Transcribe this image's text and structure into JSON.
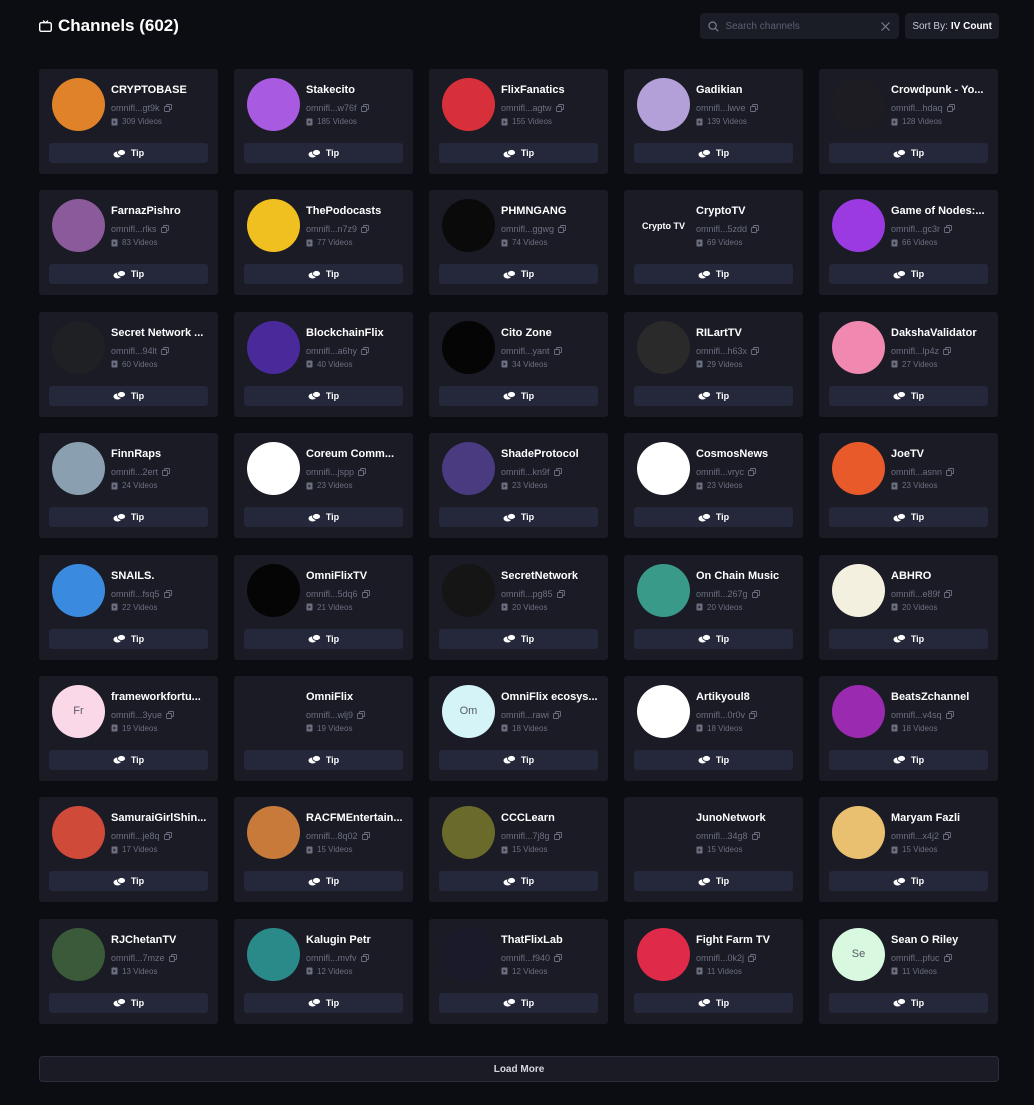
{
  "header": {
    "title": "Channels (602)",
    "search_placeholder": "Search channels",
    "sort_label": "Sort By:",
    "sort_value": "IV Count"
  },
  "tip_label": "Tip",
  "load_more_label": "Load More",
  "channels": [
    {
      "name": "CRYPTOBASE",
      "address": "omnifl...gt9k",
      "videos": "309 Videos",
      "avatar_color": "#e0822a",
      "avatar_text": ""
    },
    {
      "name": "Stakecito",
      "address": "omnifl...w76f",
      "videos": "185 Videos",
      "avatar_color": "#a85ae0",
      "avatar_text": ""
    },
    {
      "name": "FlixFanatics",
      "address": "omnifl...agtw",
      "videos": "155 Videos",
      "avatar_color": "#d8303a",
      "avatar_text": ""
    },
    {
      "name": "Gadikian",
      "address": "omnifl...lwve",
      "videos": "139 Videos",
      "avatar_color": "#b4a0d8",
      "avatar_text": ""
    },
    {
      "name": "Crowdpunk - Yo...",
      "address": "omnifl...hdaq",
      "videos": "128 Videos",
      "avatar_color": "#1c1c22",
      "avatar_text": ""
    },
    {
      "name": "FarnazPishro",
      "address": "omnifl...rlks",
      "videos": "83 Videos",
      "avatar_color": "#8a5a9a",
      "avatar_text": ""
    },
    {
      "name": "ThePodocasts",
      "address": "omnifl...n7z9",
      "videos": "77 Videos",
      "avatar_color": "#f0c020",
      "avatar_text": ""
    },
    {
      "name": "PHMNGANG",
      "address": "omnifl...ggwg",
      "videos": "74 Videos",
      "avatar_color": "#0a0a0a",
      "avatar_text": ""
    },
    {
      "name": "CryptoTV",
      "address": "omnifl...5zdd",
      "videos": "69 Videos",
      "avatar_color": "#1a1b25",
      "avatar_text": "Crypto TV"
    },
    {
      "name": "Game of Nodes:...",
      "address": "omnifl...gc3r",
      "videos": "66 Videos",
      "avatar_color": "#9a3ae0",
      "avatar_text": ""
    },
    {
      "name": "Secret Network ...",
      "address": "omnifl...94lt",
      "videos": "60 Videos",
      "avatar_color": "#1e2024",
      "avatar_text": ""
    },
    {
      "name": "BlockchainFlix",
      "address": "omnifl...a6hy",
      "videos": "40 Videos",
      "avatar_color": "#4a2a9a",
      "avatar_text": ""
    },
    {
      "name": "Cito Zone",
      "address": "omnifl...yant",
      "videos": "34 Videos",
      "avatar_color": "#050505",
      "avatar_text": ""
    },
    {
      "name": "RILartTV",
      "address": "omnifl...h63x",
      "videos": "29 Videos",
      "avatar_color": "#2a2a2a",
      "avatar_text": ""
    },
    {
      "name": "DakshaValidator",
      "address": "omnifl...lp4z",
      "videos": "27 Videos",
      "avatar_color": "#f088b0",
      "avatar_text": ""
    },
    {
      "name": "FinnRaps",
      "address": "omnifl...2ert",
      "videos": "24 Videos",
      "avatar_color": "#8aa0b0",
      "avatar_text": ""
    },
    {
      "name": "Coreum Comm...",
      "address": "omnifl...jspp",
      "videos": "23 Videos",
      "avatar_color": "#ffffff",
      "avatar_text": ""
    },
    {
      "name": "ShadeProtocol",
      "address": "omnifl...kn9f",
      "videos": "23 Videos",
      "avatar_color": "#4a3a80",
      "avatar_text": ""
    },
    {
      "name": "CosmosNews",
      "address": "omnifl...vryc",
      "videos": "23 Videos",
      "avatar_color": "#ffffff",
      "avatar_text": ""
    },
    {
      "name": "JoeTV",
      "address": "omnifl...asnn",
      "videos": "23 Videos",
      "avatar_color": "#e85a2a",
      "avatar_text": ""
    },
    {
      "name": "SNAILS.",
      "address": "omnifl...fsq5",
      "videos": "22 Videos",
      "avatar_color": "#3a8ae0",
      "avatar_text": ""
    },
    {
      "name": "OmniFlixTV",
      "address": "omnifl...5dq6",
      "videos": "21 Videos",
      "avatar_color": "#050505",
      "avatar_text": ""
    },
    {
      "name": "SecretNetwork",
      "address": "omnifl...pg85",
      "videos": "20 Videos",
      "avatar_color": "#151515",
      "avatar_text": ""
    },
    {
      "name": "On Chain Music",
      "address": "omnifl...267g",
      "videos": "20 Videos",
      "avatar_color": "#3a9a8a",
      "avatar_text": ""
    },
    {
      "name": "ABHRO",
      "address": "omnifl...e89f",
      "videos": "20 Videos",
      "avatar_color": "#f4f0e0",
      "avatar_text": ""
    },
    {
      "name": "frameworkfortu...",
      "address": "omnifl...3yue",
      "videos": "19 Videos",
      "avatar_color": "#fbd8e8",
      "avatar_text": "Fr",
      "initials": true
    },
    {
      "name": "OmniFlix",
      "address": "omnifl...wlj9",
      "videos": "19 Videos",
      "avatar_color": "#1a1b25",
      "avatar_text": ""
    },
    {
      "name": "OmniFlix ecosys...",
      "address": "omnifl...rawi",
      "videos": "18 Videos",
      "avatar_color": "#d4f4f8",
      "avatar_text": "Om",
      "initials": true
    },
    {
      "name": "Artikyoul8",
      "address": "omnifl...0r0v",
      "videos": "18 Videos",
      "avatar_color": "#ffffff",
      "avatar_text": ""
    },
    {
      "name": "BeatsZchannel",
      "address": "omnifl...v4sq",
      "videos": "18 Videos",
      "avatar_color": "#9a2ab0",
      "avatar_text": ""
    },
    {
      "name": "SamuraiGirlShin...",
      "address": "omnifl...je8q",
      "videos": "17 Videos",
      "avatar_color": "#d04a3a",
      "avatar_text": ""
    },
    {
      "name": "RACFMEntertain...",
      "address": "omnifl...8q02",
      "videos": "15 Videos",
      "avatar_color": "#c87a3a",
      "avatar_text": ""
    },
    {
      "name": "CCCLearn",
      "address": "omnifl...7j8g",
      "videos": "15 Videos",
      "avatar_color": "#6a6a2a",
      "avatar_text": ""
    },
    {
      "name": "JunoNetwork",
      "address": "omnifl...34g8",
      "videos": "15 Videos",
      "avatar_color": "#1a1b25",
      "avatar_text": ""
    },
    {
      "name": "Maryam Fazli",
      "address": "omnifl...x4j2",
      "videos": "15 Videos",
      "avatar_color": "#e8c070",
      "avatar_text": ""
    },
    {
      "name": "RJChetanTV",
      "address": "omnifl...7mze",
      "videos": "13 Videos",
      "avatar_color": "#3a5a3a",
      "avatar_text": ""
    },
    {
      "name": "Kalugin Petr",
      "address": "omnifl...mvfv",
      "videos": "12 Videos",
      "avatar_color": "#2a8a8a",
      "avatar_text": ""
    },
    {
      "name": "ThatFlixLab",
      "address": "omnifl...f940",
      "videos": "12 Videos",
      "avatar_color": "#1a1a2a",
      "avatar_text": ""
    },
    {
      "name": "Fight Farm TV",
      "address": "omnifl...0k2j",
      "videos": "11 Videos",
      "avatar_color": "#e02a4a",
      "avatar_text": ""
    },
    {
      "name": "Sean O Riley",
      "address": "omnifl...pfuc",
      "videos": "11 Videos",
      "avatar_color": "#d8f8e0",
      "avatar_text": "Se",
      "initials": true
    }
  ],
  "colors": {
    "background": "#0c0d12",
    "card": "#1a1b25",
    "tip_button": "#25283a",
    "muted_text": "#6b6f80"
  }
}
